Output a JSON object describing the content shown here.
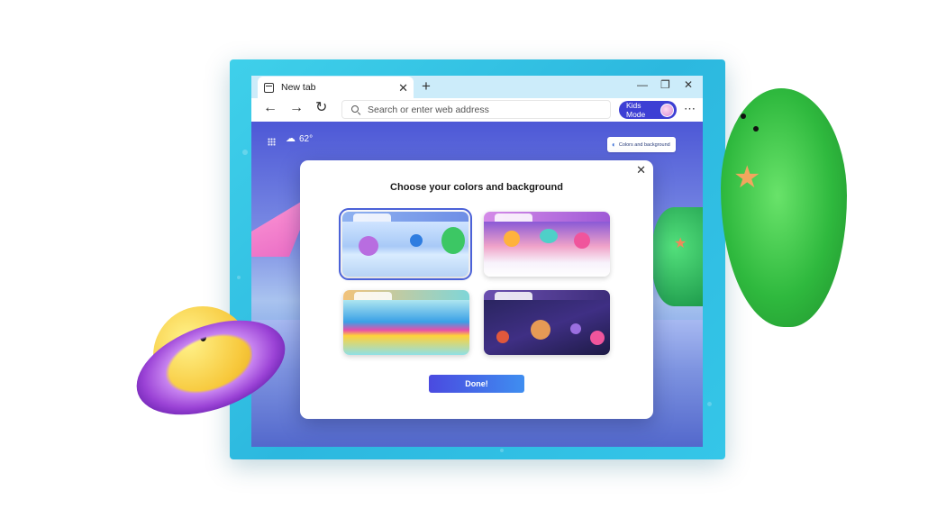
{
  "browser": {
    "tab_title": "New tab",
    "address_placeholder": "Search or enter web address",
    "kids_mode_label": "Kids Mode"
  },
  "new_tab_page": {
    "weather_temp": "62°",
    "colors_button_label": "Colors and background"
  },
  "dialog": {
    "title": "Choose your colors and background",
    "done_label": "Done!",
    "themes": [
      {
        "selected": true
      },
      {
        "selected": false
      },
      {
        "selected": false
      },
      {
        "selected": false
      }
    ]
  },
  "colors": {
    "accent": "#3d3fd4",
    "frame": "#2cb8df",
    "done_gradient_start": "#4a4ae0",
    "done_gradient_end": "#3f8ef0"
  },
  "icons": [
    "browser-tab-icon",
    "close-icon",
    "plus-icon",
    "minimize-icon",
    "restore-icon",
    "back-arrow-icon",
    "forward-arrow-icon",
    "refresh-icon",
    "search-icon",
    "kids-avatar-icon",
    "more-icon",
    "apps-grid-icon",
    "weather-icon",
    "palette-icon",
    "star-icon"
  ]
}
